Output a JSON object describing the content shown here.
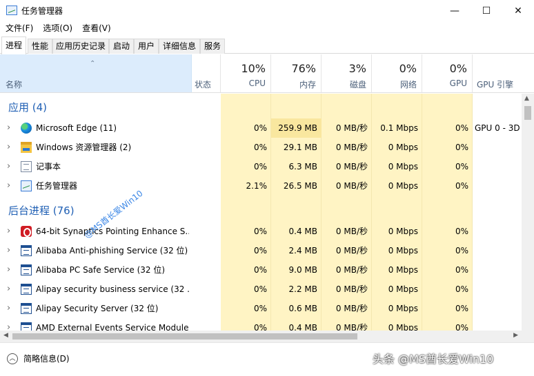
{
  "window": {
    "title": "任务管理器",
    "min_glyph": "—",
    "max_glyph": "☐",
    "close_glyph": "✕"
  },
  "menu": [
    "文件(F)",
    "选项(O)",
    "查看(V)"
  ],
  "tabs": [
    "进程",
    "性能",
    "应用历史记录",
    "启动",
    "用户",
    "详细信息",
    "服务"
  ],
  "active_tab": "进程",
  "columns": {
    "name": "名称",
    "status": "状态",
    "cpu": {
      "pct": "10%",
      "label": "CPU"
    },
    "memory": {
      "pct": "76%",
      "label": "内存"
    },
    "disk": {
      "pct": "3%",
      "label": "磁盘"
    },
    "network": {
      "pct": "0%",
      "label": "网络"
    },
    "gpu": {
      "pct": "0%",
      "label": "GPU"
    },
    "gpu_engine": "GPU 引擎"
  },
  "groups": {
    "apps": "应用 (4)",
    "background": "后台进程 (76)"
  },
  "apps": [
    {
      "name": "Microsoft Edge (11)",
      "icon": "edge-icon",
      "cpu": "0%",
      "mem": "259.9 MB",
      "disk": "0 MB/秒",
      "net": "0.1 Mbps",
      "gpu": "0%",
      "engine": "GPU 0 - 3D"
    },
    {
      "name": "Windows 资源管理器 (2)",
      "icon": "folder-icon",
      "cpu": "0%",
      "mem": "29.1 MB",
      "disk": "0 MB/秒",
      "net": "0 Mbps",
      "gpu": "0%",
      "engine": ""
    },
    {
      "name": "记事本",
      "icon": "notepad-icon",
      "cpu": "0%",
      "mem": "6.3 MB",
      "disk": "0 MB/秒",
      "net": "0 Mbps",
      "gpu": "0%",
      "engine": ""
    },
    {
      "name": "任务管理器",
      "icon": "task-manager-icon",
      "cpu": "2.1%",
      "mem": "26.5 MB",
      "disk": "0 MB/秒",
      "net": "0 Mbps",
      "gpu": "0%",
      "engine": ""
    }
  ],
  "background": [
    {
      "name": "64-bit Synaptics Pointing Enhance S...",
      "icon": "synaptics-icon",
      "cpu": "0%",
      "mem": "0.4 MB",
      "disk": "0 MB/秒",
      "net": "0 Mbps",
      "gpu": "0%"
    },
    {
      "name": "Alibaba Anti-phishing Service (32 位)",
      "icon": "app-window-icon",
      "cpu": "0%",
      "mem": "2.4 MB",
      "disk": "0 MB/秒",
      "net": "0 Mbps",
      "gpu": "0%"
    },
    {
      "name": "Alibaba PC Safe Service (32 位)",
      "icon": "app-window-icon",
      "cpu": "0%",
      "mem": "9.0 MB",
      "disk": "0 MB/秒",
      "net": "0 Mbps",
      "gpu": "0%"
    },
    {
      "name": "Alipay security business service (32 ...",
      "icon": "app-window-icon",
      "cpu": "0%",
      "mem": "2.2 MB",
      "disk": "0 MB/秒",
      "net": "0 Mbps",
      "gpu": "0%"
    },
    {
      "name": "Alipay Security Server (32 位)",
      "icon": "app-window-icon",
      "cpu": "0%",
      "mem": "0.6 MB",
      "disk": "0 MB/秒",
      "net": "0 Mbps",
      "gpu": "0%"
    },
    {
      "name": "AMD External Events Service Module",
      "icon": "app-window-icon",
      "cpu": "0%",
      "mem": "0.4 MB",
      "disk": "0 MB/秒",
      "net": "0 Mbps",
      "gpu": "0%"
    }
  ],
  "footer": {
    "fewer_details": "简略信息(D)"
  },
  "watermarks": {
    "diagonal": "@MS酋长爱Win10",
    "bottom": "头条 @MS酋长爱Win10"
  },
  "colors": {
    "header_name_bg": "#dcecfc",
    "column_highlight": "#fff4c4",
    "memory_highlight": "#f9e79f",
    "group_title": "#1f5fb4"
  }
}
